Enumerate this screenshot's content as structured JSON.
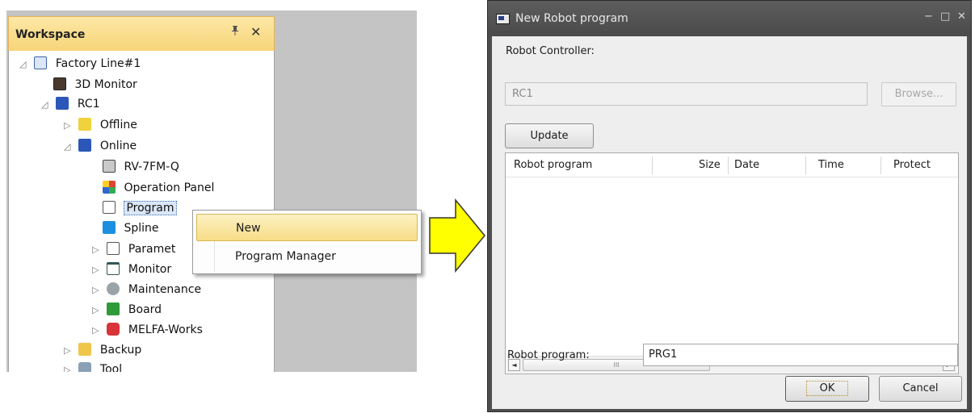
{
  "workspace": {
    "title": "Workspace",
    "pin_glyph": "1",
    "close_glyph": "✕",
    "tree": [
      {
        "label": "Factory Line#1",
        "icon": "factory-line-icon",
        "expander": "◿"
      },
      {
        "label": "3D Monitor",
        "icon": "3d-monitor-icon",
        "expander": ""
      },
      {
        "label": "RC1",
        "icon": "robot-controller-icon",
        "expander": "◿"
      },
      {
        "label": "Offline",
        "icon": "offline-icon",
        "expander": "▷"
      },
      {
        "label": "Online",
        "icon": "online-icon",
        "expander": "◿"
      },
      {
        "label": "RV-7FM-Q",
        "icon": "robot-model-icon",
        "expander": ""
      },
      {
        "label": "Operation Panel",
        "icon": "operation-panel-icon",
        "expander": ""
      },
      {
        "label": "Program",
        "icon": "program-icon",
        "expander": ""
      },
      {
        "label": "Spline",
        "icon": "spline-icon",
        "expander": ""
      },
      {
        "label": "Paramet",
        "icon": "parameter-icon",
        "expander": "▷"
      },
      {
        "label": "Monitor",
        "icon": "monitor-icon",
        "expander": "▷"
      },
      {
        "label": "Maintenance",
        "icon": "maintenance-icon",
        "expander": "▷"
      },
      {
        "label": "Board",
        "icon": "board-icon",
        "expander": "▷"
      },
      {
        "label": "MELFA-Works",
        "icon": "melfa-works-icon",
        "expander": "▷"
      },
      {
        "label": "Backup",
        "icon": "backup-icon",
        "expander": "▷"
      },
      {
        "label": "Tool",
        "icon": "tool-icon",
        "expander": "▷"
      }
    ]
  },
  "context_menu": {
    "items": [
      "New",
      "Program Manager"
    ]
  },
  "dialog": {
    "title": "New Robot program",
    "minimize_glyph": "−",
    "maximize_glyph": "□",
    "close_glyph": "✕",
    "controller_label": "Robot Controller:",
    "controller_value": "RC1",
    "browse_label": "Browse...",
    "update_label": "Update",
    "columns": [
      "Robot program",
      "Size",
      "Date",
      "Time",
      "Protect"
    ],
    "scroll_left": "◄",
    "scroll_right": "►",
    "scroll_grip": "III",
    "program_label": "Robot program:",
    "program_value": "PRG1",
    "ok_label": "OK",
    "cancel_label": "Cancel"
  },
  "colors": {
    "arrow_fill": "#ffff00",
    "menu_highlight": "#f7dd86",
    "header_gradient": "#f7d478"
  }
}
